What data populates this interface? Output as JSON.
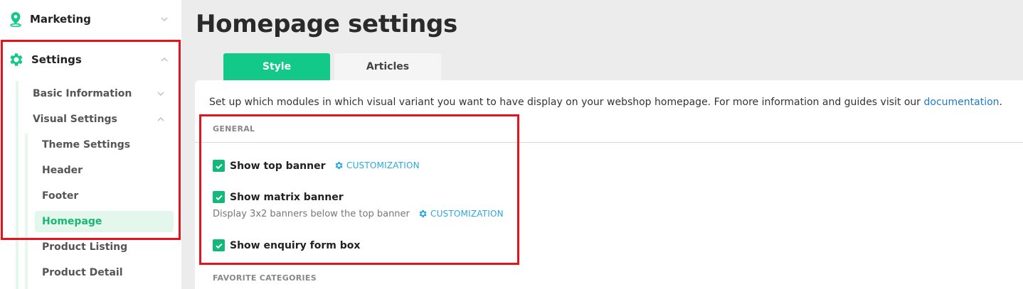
{
  "sidebar": {
    "marketing_label": "Marketing",
    "settings_label": "Settings",
    "sub_items": [
      {
        "label": "Basic Information"
      },
      {
        "label": "Visual Settings"
      }
    ],
    "visual_items": [
      {
        "label": "Theme Settings"
      },
      {
        "label": "Header"
      },
      {
        "label": "Footer"
      },
      {
        "label": "Homepage"
      },
      {
        "label": "Product Listing"
      },
      {
        "label": "Product Detail"
      }
    ]
  },
  "main": {
    "title": "Homepage settings",
    "tabs": [
      {
        "label": "Style",
        "active": true
      },
      {
        "label": "Articles",
        "active": false
      }
    ],
    "intro_text": "Set up which modules in which visual variant you want to have display on your webshop homepage. For more information and guides visit our",
    "intro_link": "documentation",
    "intro_end": ".",
    "section_general": "GENERAL",
    "options": [
      {
        "label": "Show top banner",
        "checked": true,
        "custom_label": "CUSTOMIZATION"
      },
      {
        "label": "Show matrix banner",
        "checked": true,
        "helper": "Display 3x2 banners below the top banner",
        "custom_label": "CUSTOMIZATION"
      },
      {
        "label": "Show enquiry form box",
        "checked": true
      }
    ],
    "section_favorites": "FAVORITE CATEGORIES"
  },
  "colors": {
    "accent": "#13c98a",
    "highlight_border": "#e4141e",
    "link": "#1f78c8",
    "customization": "#2aa8e0"
  }
}
